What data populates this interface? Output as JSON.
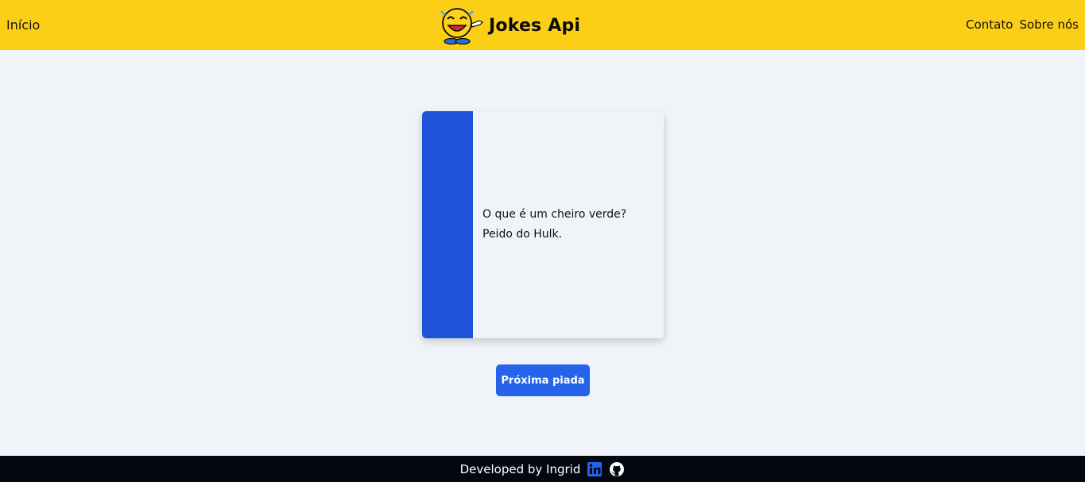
{
  "header": {
    "home_label": "Início",
    "brand_name": "Jokes Api",
    "nav_right": [
      "Contato",
      "Sobre nós"
    ]
  },
  "joke": {
    "question": "O que é um cheiro verde?",
    "answer": "Peido do Hulk."
  },
  "actions": {
    "next_label": "Próxima piada"
  },
  "footer": {
    "credit": "Developed by Ingrid",
    "icons": [
      "linkedin-icon",
      "github-icon"
    ]
  },
  "colors": {
    "header_bg": "#fccf17",
    "page_bg": "#f0f3f8",
    "accent_stripe": "#1f52d9",
    "button_bg": "#2563eb",
    "footer_bg": "#030712"
  }
}
